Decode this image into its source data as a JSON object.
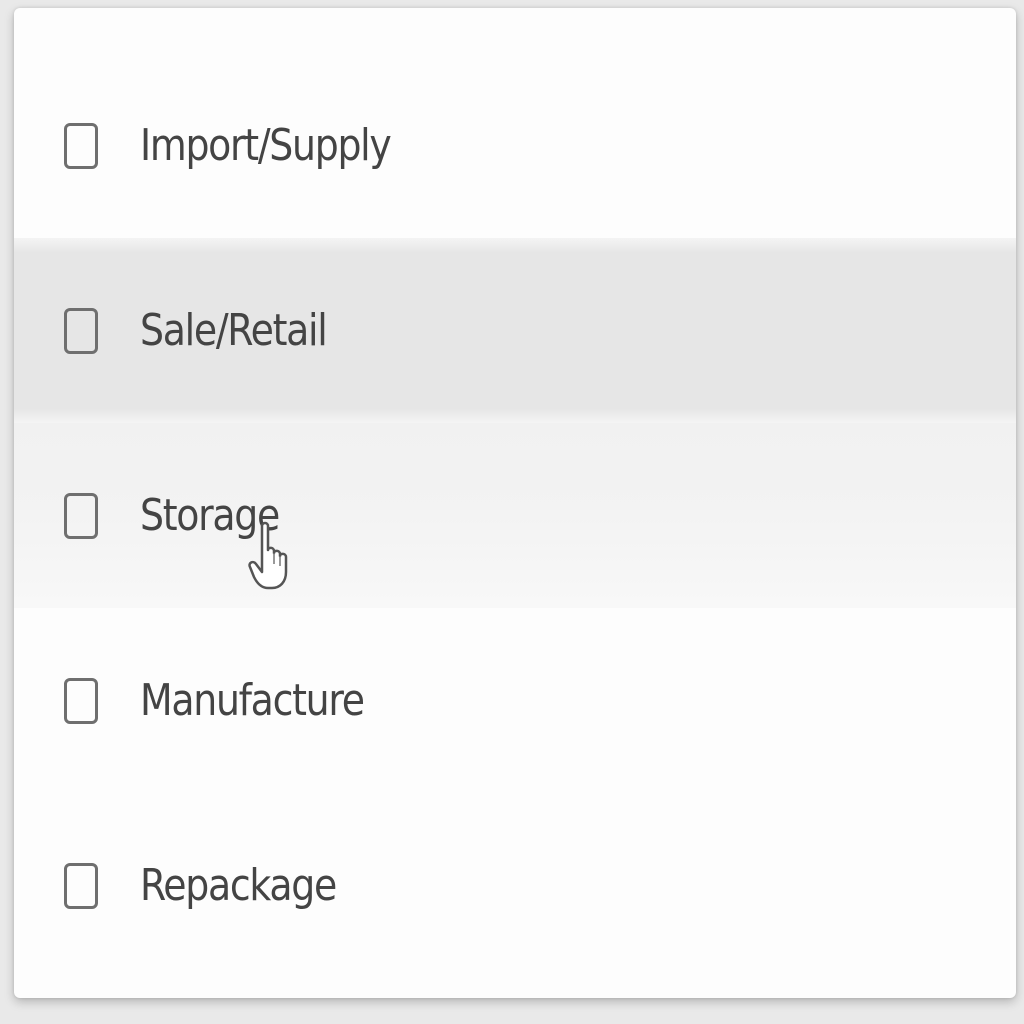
{
  "options": [
    {
      "label": "Import/Supply",
      "checked": false
    },
    {
      "label": "Sale/Retail",
      "checked": false
    },
    {
      "label": "Storage",
      "checked": false
    },
    {
      "label": "Manufacture",
      "checked": false
    },
    {
      "label": "Repackage",
      "checked": false
    }
  ],
  "colors": {
    "text": "#444444",
    "checkbox_border": "#6f6f6f",
    "hover_row": "#e6e6e6",
    "panel": "#fdfdfd"
  },
  "icons": {
    "cursor": "hand-pointer-icon"
  }
}
